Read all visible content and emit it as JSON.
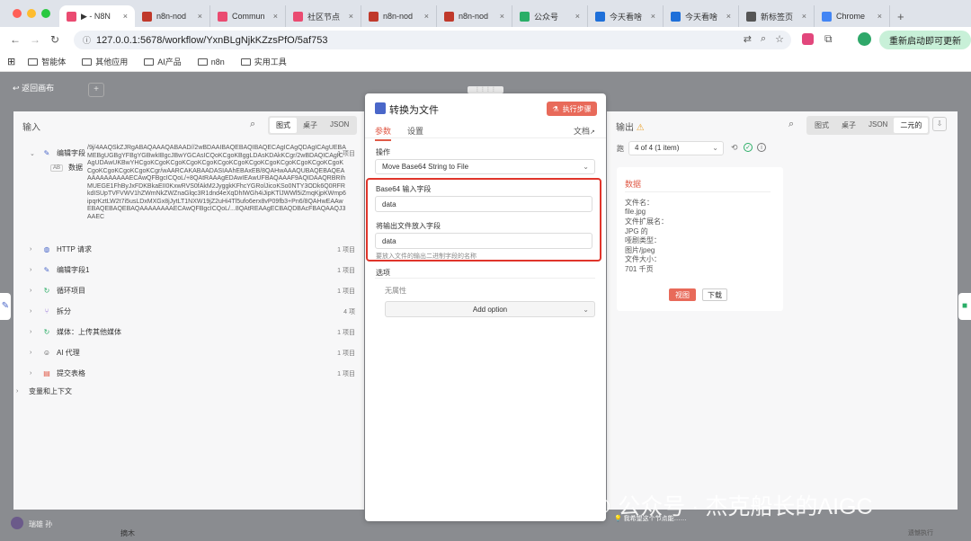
{
  "browser": {
    "tabs": [
      {
        "label": "▶ - N8N",
        "icon": "n8n-icon",
        "color": "#ea4b71"
      },
      {
        "label": "n8n-nod",
        "icon": "n8n-nodes-icon",
        "color": "#c0392b"
      },
      {
        "label": "Commun",
        "icon": "community-icon",
        "color": "#ea4b71"
      },
      {
        "label": "社区节点",
        "icon": "community-icon",
        "color": "#ea4b71"
      },
      {
        "label": "n8n-nod",
        "icon": "n8n-nodes-icon",
        "color": "#c0392b"
      },
      {
        "label": "n8n-nod",
        "icon": "n8n-nodes-icon",
        "color": "#c0392b"
      },
      {
        "label": "公众号",
        "icon": "wechat-icon",
        "color": "#2aae67"
      },
      {
        "label": "今天看啥",
        "icon": "reader-icon",
        "color": "#1e6fd9"
      },
      {
        "label": "今天看啥",
        "icon": "reader-icon",
        "color": "#1e6fd9"
      },
      {
        "label": "新标签页",
        "icon": "newtab-icon",
        "color": "#555555"
      },
      {
        "label": "Chrome",
        "icon": "chrome-icon",
        "color": "#4285f4"
      }
    ],
    "url": "127.0.0.1:5678/workflow/YxnBLgNjkKZzsPfO/5af753",
    "reload_button": "重新启动即可更新",
    "bookmarks": [
      "智能体",
      "其他应用",
      "AI产品",
      "n8n",
      "实用工具"
    ]
  },
  "canvas": {
    "back_label": "返回画布"
  },
  "input": {
    "title": "输入",
    "modes": [
      "图式",
      "桌子",
      "JSON"
    ],
    "nodes": [
      {
        "name": "编辑字段",
        "count": "1 项目",
        "expanded": true,
        "icon": "pencil-icon"
      },
      {
        "name": "HTTP 请求",
        "count": "1 项目",
        "icon": "globe-icon"
      },
      {
        "name": "编辑字段1",
        "count": "1 项目",
        "icon": "pencil-icon"
      },
      {
        "name": "循环项目",
        "count": "1 项目",
        "icon": "loop-icon"
      },
      {
        "name": "拆分",
        "count": "4 项",
        "icon": "split-icon"
      },
      {
        "name": "媒体：上传其他媒体",
        "count": "1 项目",
        "icon": "media-icon"
      },
      {
        "name": "AI 代理",
        "count": "1 项目",
        "icon": "robot-icon"
      },
      {
        "name": "提交表格",
        "count": "1 项目",
        "icon": "form-icon"
      }
    ],
    "field_name": "数据",
    "field_type": "AB",
    "binary_value": "/9j/4AAQSkZJRgABAQAAAQABAAD//2wBDAAIBAQEBAQIBAQECAgICAgQDAgICAgUEBAMEBgUGBgYFBgYGBwkIBgcJBwYGCAsICQoKCgoKBggLDAsKDAkKCgr/2wBDAQICAgICAgUDAwUKBwYHCgoKCgoKCgoKCgoKCgoKCgoKCgoKCgoKCgoKCgoKCgoKCgoKCgoKCgoKCgoKCgoKCgoKCgr/wAARCAKABAADASIAAhEBAxEB/8QAHwAAAQUBAQEBAQEAAAAAAAAAAAECAwQFBgcICQoL/+8QAtRAAAgEDAwIEAwUFBAQAAAF9AQIDAAQRBRIhMUEGE1FhByJxFDKBkaEII0KxwRVS0fAkM2JyggkKFhcYGRolJicoKSo0NTY3ODk6Q0RFRkdISUpTVFVWV1hZWmNkZWZnaGlqc3R1dnd4eXqDhIWGh4iJipKTlJWWl5iZmqKjpKWmp6ipqrKztLW2t7i5usLDxMXGx8jJytLT1NXW19jZ2uHi4Tl5ufo6erx8vP09fb3+Pn6/8QAHwEAAwEBAQEBAQEBAQAAAAAAAAECAwQFBgcICQoL/...8QAtREAAgECBAQDBAcFBAQAAQJ3AAEC"
  },
  "node_panel": {
    "title": "转换为文件",
    "execute_button": "执行步骤",
    "tabs": [
      "参数",
      "设置"
    ],
    "docs_link": "文档",
    "operation_label": "操作",
    "operation_value": "Move Base64 String to File",
    "base64_label": "Base64 输入字段",
    "base64_value": "data",
    "output_field_label": "将输出文件放入字段",
    "output_field_value": "data",
    "hint": "要放入文件的输出二进制字段的名称",
    "options_label": "选项",
    "no_property": "无属性",
    "add_option": "Add option"
  },
  "output": {
    "title": "输出",
    "modes": [
      "图式",
      "桌子",
      "JSON",
      "二元的"
    ],
    "run_label": "跑",
    "run_select": "4 of 4 (1 item)",
    "card_title": "数据",
    "lines": [
      "文件名：",
      "file.jpg",
      "文件扩展名：",
      "JPG 的",
      "哑剧类型：",
      "图片/jpeg",
      "文件大小：",
      "701 千页"
    ],
    "view_button": "视图",
    "download_button": "下载"
  },
  "footer": {
    "user": "瑞雄 孙",
    "hint": "我希望这个节点能……",
    "bottom_left": "摘木",
    "bottom_right": "遗憾执行"
  },
  "watermark": "公众号 · 杰克船长的AIGC"
}
